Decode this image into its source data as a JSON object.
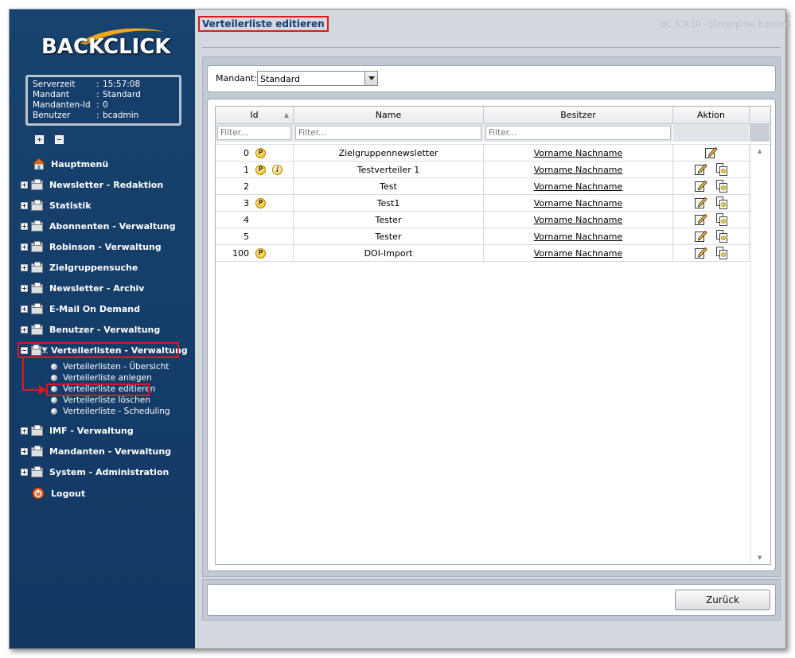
{
  "brand": {
    "logo_text": "BACKCLICK"
  },
  "server_info": [
    {
      "label": "Serverzeit",
      "value": "15:57:08"
    },
    {
      "label": "Mandant",
      "value": "Standard"
    },
    {
      "label": "Mandanten-Id",
      "value": "0"
    },
    {
      "label": "Benutzer",
      "value": "bcadmin"
    }
  ],
  "server_sep": ":",
  "nav": {
    "hauptmenu": "Hauptmenü",
    "items": [
      "Newsletter - Redaktion",
      "Statistik",
      "Abonnenten - Verwaltung",
      "Robinson - Verwaltung",
      "Zielgruppensuche",
      "Newsletter - Archiv",
      "E-Mail On Demand",
      "Benutzer - Verwaltung",
      "Verteilerlisten - Verwaltung",
      "IMF - Verwaltung",
      "Mandanten - Verwaltung",
      "System - Administration"
    ],
    "sub_items": [
      "Verteilerlisten - Übersicht",
      "Verteilerliste anlegen",
      "Verteilerliste editieren",
      "Verteilerliste löschen",
      "Verteilerliste - Scheduling"
    ],
    "logout": "Logout"
  },
  "header": {
    "title": "Verteilerliste editieren",
    "version": "BC 5.9.10 - [Enterprise Edition]"
  },
  "mandant": {
    "label": "Mandant:",
    "selected": "Standard"
  },
  "table": {
    "columns": [
      "Id",
      "Name",
      "Besitzer",
      "Aktion"
    ],
    "filter_placeholder": "Filter...",
    "rows": [
      {
        "id": "0",
        "badges": [
          "P"
        ],
        "name": "Zielgruppennewsletter",
        "owner": "Vorname Nachname",
        "actions": [
          "edit"
        ]
      },
      {
        "id": "1",
        "badges": [
          "P",
          "i"
        ],
        "name": "Testverteiler 1",
        "owner": "Vorname Nachname",
        "actions": [
          "edit",
          "copy"
        ]
      },
      {
        "id": "2",
        "badges": [],
        "name": "Test",
        "owner": "Vorname Nachname",
        "actions": [
          "edit",
          "copy"
        ]
      },
      {
        "id": "3",
        "badges": [
          "P"
        ],
        "name": "Test1",
        "owner": "Vorname Nachname",
        "actions": [
          "edit",
          "copy"
        ]
      },
      {
        "id": "4",
        "badges": [],
        "name": "Tester",
        "owner": "Vorname Nachname",
        "actions": [
          "edit",
          "copy"
        ]
      },
      {
        "id": "5",
        "badges": [],
        "name": "Tester",
        "owner": "Vorname Nachname",
        "actions": [
          "edit",
          "copy"
        ]
      },
      {
        "id": "100",
        "badges": [
          "P"
        ],
        "name": "DOI-Import",
        "owner": "Vorname Nachname",
        "actions": [
          "edit",
          "copy"
        ]
      }
    ]
  },
  "footer": {
    "back_label": "Zurück"
  },
  "colors": {
    "sidebar": "#153c6a",
    "highlight": "#e0161d",
    "title": "#163c78"
  },
  "icons": {
    "edit": "edit-pencil-icon",
    "copy": "copy-icon",
    "badge_p": "p-badge-icon",
    "badge_i": "info-badge-icon",
    "folder": "folder-icon",
    "home": "home-icon",
    "logout": "logout-icon"
  }
}
